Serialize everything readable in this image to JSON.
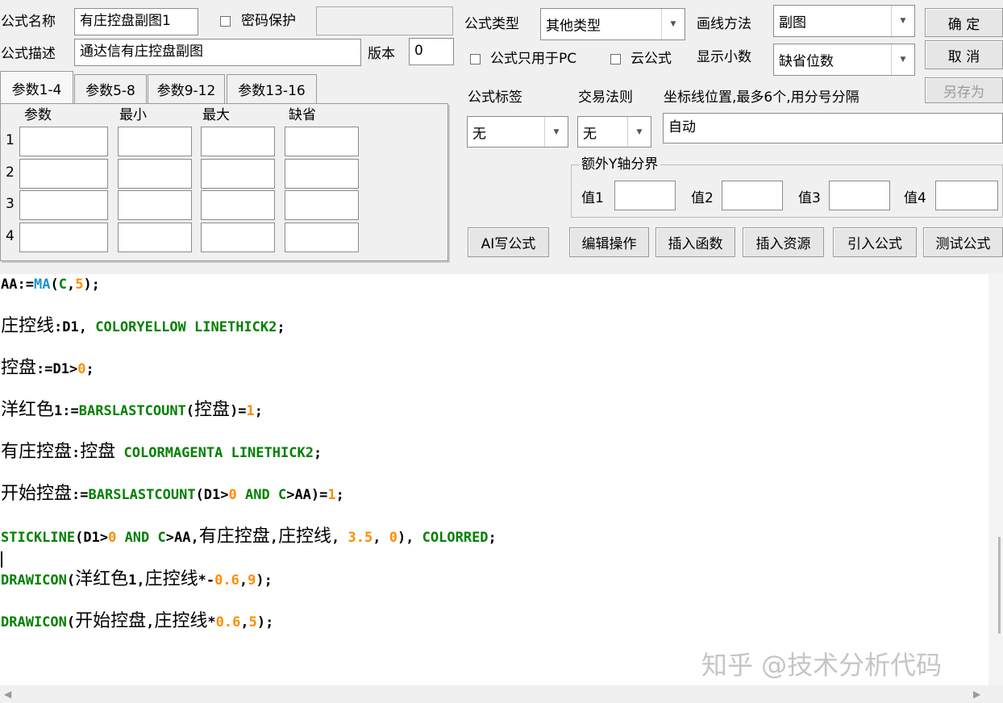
{
  "top": {
    "formula_name_label": "公式名称",
    "formula_name_value": "有庄控盘副图1",
    "password_label": "密码保护",
    "formula_desc_label": "公式描述",
    "formula_desc_value": "通达信有庄控盘副图",
    "version_label": "版本",
    "version_value": "0",
    "formula_type_label": "公式类型",
    "formula_type_value": "其他类型",
    "draw_method_label": "画线方法",
    "draw_method_value": "副图",
    "pc_only_label": "公式只用于PC",
    "cloud_label": "云公式",
    "decimals_label": "显示小数",
    "decimals_value": "缺省位数",
    "confirm_label": "确 定",
    "cancel_label": "取 消",
    "save_as_label": "另存为"
  },
  "tabs": [
    "参数1-4",
    "参数5-8",
    "参数9-12",
    "参数13-16"
  ],
  "params": {
    "headers": [
      "参数",
      "最小",
      "最大",
      "缺省"
    ],
    "rows": [
      "1",
      "2",
      "3",
      "4"
    ]
  },
  "right": {
    "tag_label": "公式标签",
    "tag_value": "无",
    "rule_label": "交易法则",
    "rule_value": "无",
    "coord_label": "坐标线位置,最多6个,用分号分隔",
    "coord_value": "自动",
    "yaxis_group": "额外Y轴分界",
    "v1": "值1",
    "v2": "值2",
    "v3": "值3",
    "v4": "值4"
  },
  "buttons": {
    "ai": "AI写公式",
    "edit": "编辑操作",
    "insert_func": "插入函数",
    "insert_res": "插入资源",
    "import": "引入公式",
    "test": "测试公式"
  },
  "code": {
    "l1": {
      "a": "AA:=",
      "b": "MA",
      "c": "(",
      "d": "C",
      "e": ",",
      "f": "5",
      "g": ");"
    },
    "l2": {
      "a": "庄控线",
      "b": ":D1, ",
      "c": "COLORYELLOW LINETHICK2",
      "d": ";"
    },
    "l3": {
      "a": "控盘",
      "b": ":=D1>",
      "c": "0",
      "d": ";"
    },
    "l4": {
      "a": "洋红色",
      "b": "1:=",
      "c": "BARSLASTCOUNT",
      "d": "(",
      "e": "控盘",
      "f": ")=",
      "g": "1",
      "h": ";"
    },
    "l5": {
      "a": "有庄控盘",
      "b": ":",
      "c": "控盘",
      "d": " ",
      "e": "COLORMAGENTA LINETHICK2",
      "f": ";"
    },
    "l6": {
      "a": "开始控盘",
      "b": ":=",
      "c": "BARSLASTCOUNT",
      "d": "(D1>",
      "e": "0",
      "f": " AND ",
      "g": "C",
      "h": ">AA)=",
      "i": "1",
      "j": ";"
    },
    "l7": {
      "a": "STICKLINE",
      "b": "(D1>",
      "c": "0",
      "d": " AND ",
      "e": "C",
      "f": ">AA,",
      "g": "有庄控盘",
      "h": ",",
      "i": "庄控线",
      "j": ", ",
      "k": "3.5",
      "l": ", ",
      "m": "0",
      "n": "), ",
      "o": "COLORRED",
      "p": ";"
    },
    "l8": {
      "a": "DRAWICON",
      "b": "(",
      "c": "洋红色",
      "d": "1,",
      "e": "庄控线",
      "f": "*-",
      "g": "0.6",
      "h": ",",
      "i": "9",
      "j": ");"
    },
    "l9": {
      "a": "DRAWICON",
      "b": "(",
      "c": "开始控盘",
      "d": ",",
      "e": "庄控线",
      "f": "*",
      "g": "0.6",
      "h": ",",
      "i": "5",
      "j": ");"
    }
  },
  "watermark": "知乎 @技术分析代码"
}
